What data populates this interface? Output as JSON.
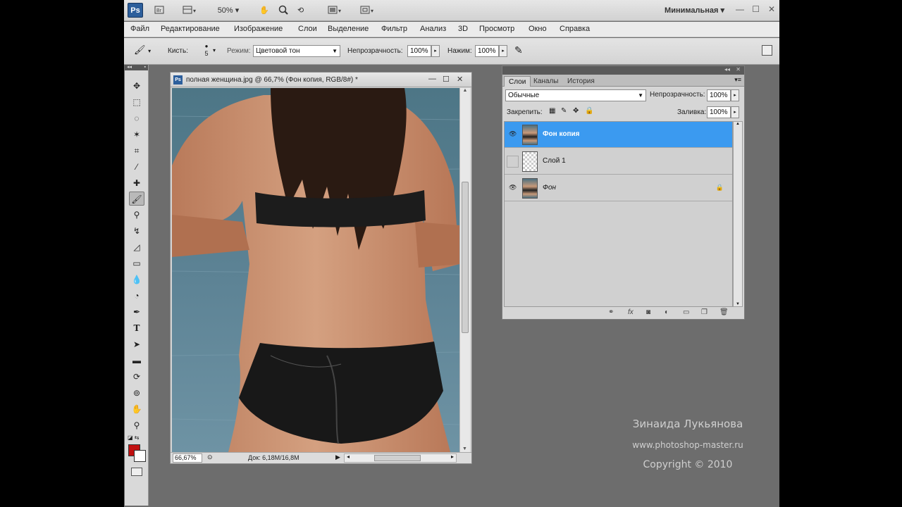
{
  "app": {
    "logo": "Ps",
    "zoom_level": "50%",
    "workspace": "Минимальная"
  },
  "menu": [
    "Файл",
    "Редактирование",
    "Изображение",
    "Слои",
    "Выделение",
    "Фильтр",
    "Анализ",
    "3D",
    "Просмотр",
    "Окно",
    "Справка"
  ],
  "options": {
    "brush_label": "Кисть:",
    "brush_size": "5",
    "mode_label": "Режим:",
    "mode_value": "Цветовой тон",
    "opacity_label": "Непрозрачность:",
    "opacity_value": "100%",
    "pressure_label": "Нажим:",
    "pressure_value": "100%"
  },
  "document": {
    "title": "полная женщина.jpg @ 66,7% (Фон копия, RGB/8#) *",
    "zoom": "66,67%",
    "doc_info": "Док: 6,18M/16,8M"
  },
  "layers_panel": {
    "tabs": [
      "Слои",
      "Каналы",
      "История"
    ],
    "blend_mode": "Обычные",
    "opacity_label": "Непрозрачность:",
    "opacity_value": "100%",
    "lock_label": "Закрепить:",
    "fill_label": "Заливка:",
    "fill_value": "100%",
    "layers": [
      {
        "name": "Фон копия",
        "visible": true,
        "selected": true
      },
      {
        "name": "Слой 1",
        "visible": false,
        "selected": false
      },
      {
        "name": "Фон",
        "visible": true,
        "selected": false,
        "locked": true
      }
    ]
  },
  "watermark": {
    "author": "Зинаида Лукьянова",
    "site": "www.photoshop-master.ru",
    "copyright": "Copyright © 2010"
  },
  "colors": {
    "foreground": "#c11010",
    "background": "#ffffff",
    "selection": "#3b9af0"
  }
}
